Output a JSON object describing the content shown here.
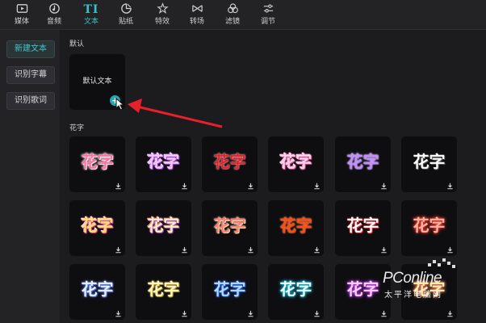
{
  "toolbar": {
    "tabs": [
      {
        "label": "媒体",
        "icon": "media-icon"
      },
      {
        "label": "音频",
        "icon": "audio-icon"
      },
      {
        "label": "文本",
        "icon": "text-icon",
        "glyph": "TI",
        "active": true
      },
      {
        "label": "贴纸",
        "icon": "sticker-icon"
      },
      {
        "label": "特效",
        "icon": "effects-icon"
      },
      {
        "label": "转场",
        "icon": "transition-icon"
      },
      {
        "label": "滤镜",
        "icon": "filter-icon"
      },
      {
        "label": "调节",
        "icon": "adjust-icon"
      }
    ]
  },
  "sidebar": {
    "items": [
      {
        "label": "新建文本",
        "active": true
      },
      {
        "label": "识别字幕"
      },
      {
        "label": "识别歌词"
      }
    ]
  },
  "main": {
    "default_section": "默认",
    "default_card_text": "默认文本",
    "fancy_section": "花字",
    "fancy_text": "花字"
  },
  "watermark": {
    "line1": "PConline",
    "line2": "太平洋电脑网"
  },
  "colors": {
    "accent": "#36c3c9",
    "arrow": "#e8202a"
  }
}
